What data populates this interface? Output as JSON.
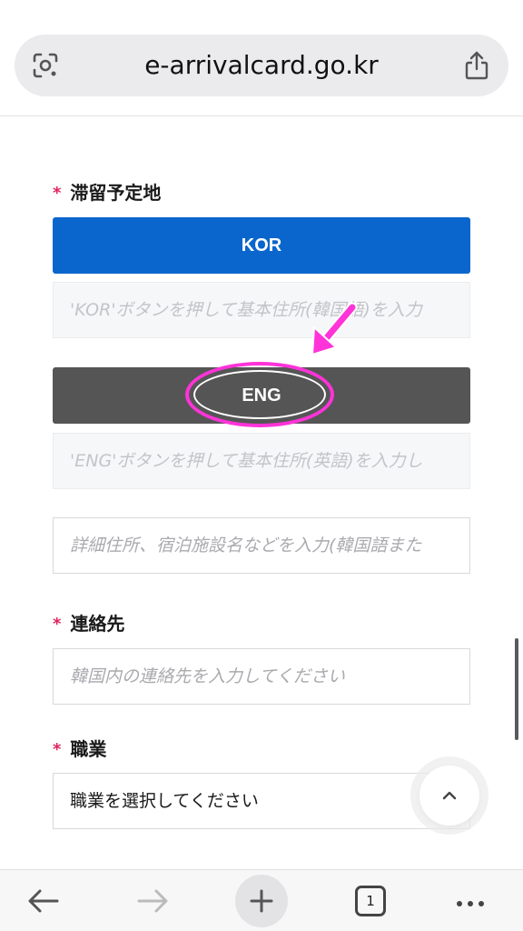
{
  "browser": {
    "url": "e-arrivalcard.go.kr",
    "open_tabs": "1"
  },
  "form": {
    "residence": {
      "required_mark": "*",
      "label": "滞留予定地",
      "kor_button": "KOR",
      "kor_field_placeholder": "'KOR'ボタンを押して基本住所(韓国語)を入力",
      "eng_button": "ENG",
      "eng_field_placeholder": "'ENG'ボタンを押して基本住所(英語)を入力し",
      "detail_placeholder": "詳細住所、宿泊施設名などを入力(韓国語また"
    },
    "contact": {
      "required_mark": "*",
      "label": "連絡先",
      "placeholder": "韓国内の連絡先を入力してください"
    },
    "occupation": {
      "required_mark": "*",
      "label": "職業",
      "selected": "職業を選択してください"
    }
  },
  "annotation": {
    "highlight_color": "#ff33d8"
  },
  "colors": {
    "kor_button": "#0a66cc",
    "eng_button": "#555555",
    "required": "#e0245e"
  },
  "icons": [
    "google-lens-icon",
    "share-icon",
    "scroll-to-top-icon",
    "back-arrow-icon",
    "forward-arrow-icon",
    "new-tab-plus-icon",
    "tab-switcher-icon",
    "more-menu-icon",
    "annotation-arrow-icon"
  ]
}
